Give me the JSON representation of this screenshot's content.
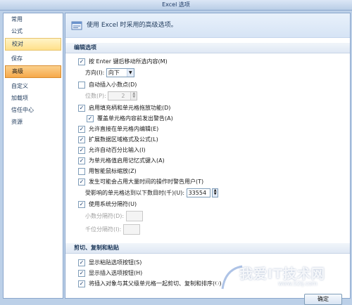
{
  "window": {
    "title": "Excel 选项"
  },
  "sidebar": {
    "items": [
      {
        "label": "常用"
      },
      {
        "label": "公式"
      },
      {
        "label": "校对"
      },
      {
        "label": "保存"
      },
      {
        "label": "高级"
      },
      {
        "label": "自定义"
      },
      {
        "label": "加载项"
      },
      {
        "label": "信任中心"
      },
      {
        "label": "资源"
      }
    ]
  },
  "header": {
    "text": "使用 Excel 时采用的高级选项。"
  },
  "editing": {
    "title": "编辑选项",
    "move_after_enter": "按 Enter 键后移动所选内容(M)",
    "direction_label": "方向(I):",
    "direction_value": "向下",
    "auto_decimal": "自动插入小数点(D)",
    "places_label": "位数(P):",
    "places_value": "2",
    "fill_handle": "启用填充柄和单元格拖放功能(D)",
    "alert_overwrite": "覆盖单元格内容前发出警告(A)",
    "edit_in_cell": "允许直接在单元格内编辑(E)",
    "extend_formats": "扩展数据区域格式及公式(L)",
    "auto_percent": "允许自动百分比输入(I)",
    "autocomplete": "为单元格值启用记忆式键入(A)",
    "intellimouse": "用智能鼠标缩放(Z)",
    "alert_slow": "发生可能会占用大量时间的操作时警告用户(T)",
    "cells_label": "受影响的单元格达到以下数目时(千)(U):",
    "cells_value": "33554",
    "system_separators": "使用系统分隔符(U)",
    "decimal_sep_label": "小数分隔符(D):",
    "thousands_sep_label": "千位分隔符(I):"
  },
  "cutcopy": {
    "title": "剪切、复制和粘贴",
    "paste_options": "显示粘贴选项按钮(S)",
    "insert_options": "显示插入选项按钮(H)",
    "cut_copy_sort": "将插入对象与其父级单元格一起剪切、复制和排序(O)"
  },
  "buttons": {
    "ok": "确定"
  },
  "watermark": {
    "text": "我爱IT技术网",
    "url": "www.52ij.com"
  },
  "colors": {
    "selected": "#f6a94b",
    "hover": "#ffe08a",
    "section": "#dfe8f4"
  }
}
